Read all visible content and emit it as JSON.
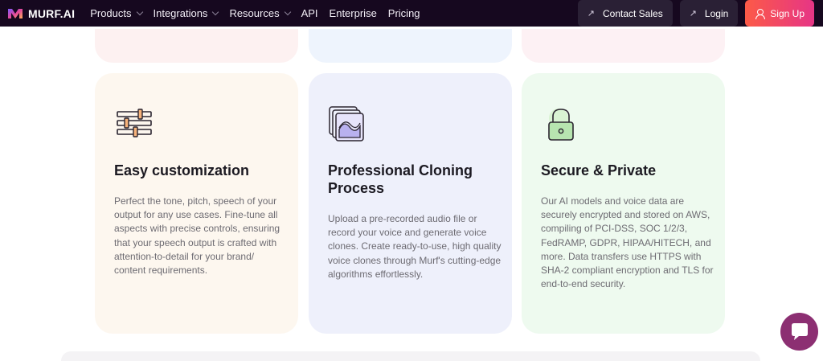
{
  "nav": {
    "logo_text": "MURF.AI",
    "items": [
      {
        "label": "Products",
        "has_dropdown": true
      },
      {
        "label": "Integrations",
        "has_dropdown": true
      },
      {
        "label": "Resources",
        "has_dropdown": true
      },
      {
        "label": "API",
        "has_dropdown": false
      },
      {
        "label": "Enterprise",
        "has_dropdown": false
      },
      {
        "label": "Pricing",
        "has_dropdown": false
      }
    ],
    "contact_sales": "Contact Sales",
    "login": "Login",
    "signup": "Sign Up"
  },
  "cards": [
    {
      "icon": "sliders-icon",
      "title": "Easy customization",
      "description": "Perfect the tone, pitch, speech of your output for any use cases. Fine-tune all aspects with precise controls, ensuring that your speech output is crafted with attention-to-detail for your brand/ content requirements."
    },
    {
      "icon": "voice-clone-icon",
      "title": "Professional Cloning Process",
      "description": "Upload a pre-recorded audio file or record your voice and generate voice clones. Create ready-to-use, high quality voice clones through Murf's cutting-edge algorithms effortlessly."
    },
    {
      "icon": "lock-icon",
      "title": "Secure & Private",
      "description": "Our AI models and voice data are securely encrypted and stored on AWS, compiling of PCI-DSS, SOC 1/2/3, FedRAMP, GDPR, HIPAA/HITECH, and more. Data transfers use HTTPS with SHA-2 compliant encryption and TLS for end-to-end security."
    }
  ],
  "colors": {
    "nav_bg": "#16081f",
    "signup_gradient_start": "#fc5a47",
    "signup_gradient_end": "#e63586",
    "chat_button": "#8c2f72"
  }
}
